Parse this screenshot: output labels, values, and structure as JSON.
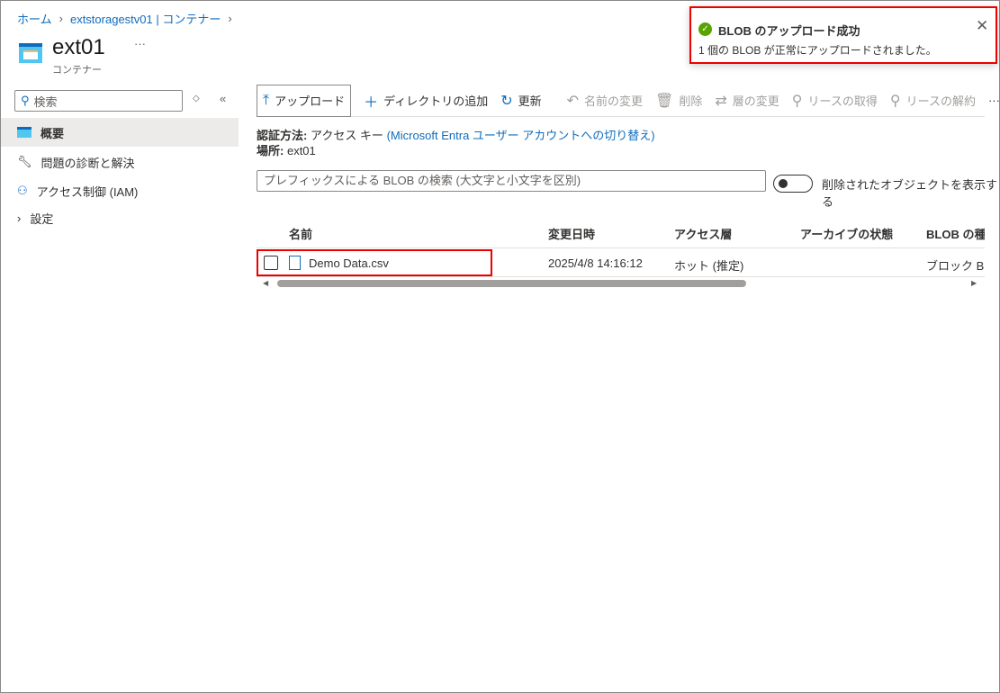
{
  "breadcrumb": [
    "ホーム",
    "extstoragestv01 | コンテナー"
  ],
  "header": {
    "title": "ext01",
    "subtitle": "コンテナー",
    "more": "···"
  },
  "sidebar": {
    "search_placeholder": "検索",
    "items": [
      {
        "label": "概要"
      },
      {
        "label": "問題の診断と解決"
      },
      {
        "label": "アクセス制御 (IAM)"
      },
      {
        "label": "設定"
      }
    ]
  },
  "toolbar": {
    "upload": "アップロード",
    "add_dir": "ディレクトリの追加",
    "refresh": "更新",
    "rename": "名前の変更",
    "delete": "削除",
    "change_tier": "層の変更",
    "acquire_lease": "リースの取得",
    "break_lease": "リースの解約",
    "more": "···"
  },
  "info": {
    "auth_label": "認証方法:",
    "auth_value": "アクセス キー",
    "auth_link": "(Microsoft Entra ユーザー アカウントへの切り替え)",
    "loc_label": "場所:",
    "loc_value": "ext01"
  },
  "filter": {
    "placeholder": "プレフィックスによる BLOB の検索 (大文字と小文字を区別)",
    "toggle_label": "削除されたオブジェクトを表示する"
  },
  "table": {
    "headers": [
      "名前",
      "変更日時",
      "アクセス層",
      "アーカイブの状態",
      "BLOB の種類"
    ],
    "rows": [
      {
        "name": "Demo Data.csv",
        "modified": "2025/4/8 14:16:12",
        "tier": "ホット (推定)",
        "archive": "",
        "type": "ブロック BLOB"
      }
    ]
  },
  "toast": {
    "title": "BLOB のアップロード成功",
    "message": "1 個の BLOB が正常にアップロードされました。"
  }
}
